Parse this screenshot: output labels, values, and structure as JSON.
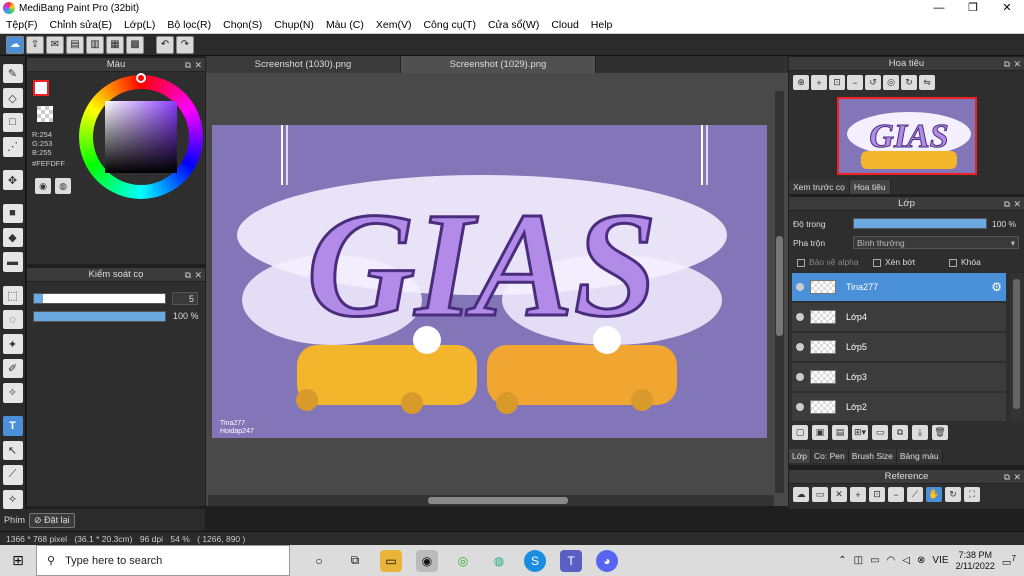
{
  "window": {
    "title": "MediBang Paint Pro (32bit)",
    "minimize": "—",
    "maximize": "❐",
    "close": "✕"
  },
  "menu": [
    "Tệp(F)",
    "Chỉnh sửa(E)",
    "Lớp(L)",
    "Bộ lọc(R)",
    "Chọn(S)",
    "Chụp(N)",
    "Màu (C)",
    "Xem(V)",
    "Công cụ(T)",
    "Cửa sổ(W)",
    "Cloud",
    "Help"
  ],
  "color_panel": {
    "title": "Màu",
    "r": "R:254",
    "g": "G:253",
    "b": "B:255",
    "hex": "#FEFDFF"
  },
  "brush_panel": {
    "title": "Kiểm soát cọ",
    "size_value": "5",
    "size_fraction": 0.07,
    "opacity_value": "100 %",
    "opacity_fraction": 1.0
  },
  "bottom_left": {
    "label": "Phím",
    "reset_label": "Đặt lại"
  },
  "tabs": [
    "Screenshot (1030).png",
    "Screenshot (1029).png"
  ],
  "artwork": {
    "title_text": "GIAS",
    "signature_line1": "Tina277",
    "signature_line2": "Hoidap247"
  },
  "navigator": {
    "title": "Hoa tiêu",
    "tab_preview": "Xem trước cọ",
    "tab_nav": "Hoa tiêu",
    "preview_text": "GIAS"
  },
  "layer_panel": {
    "title": "Lớp",
    "opacity_label": "Độ trong",
    "opacity_value": "100 %",
    "blend_label": "Pha trộn",
    "blend_value": "Bình thường",
    "protect_alpha": "Bảo vệ alpha",
    "clip": "Xén bớt",
    "lock": "Khóa",
    "layers": [
      {
        "name": "Tina277"
      },
      {
        "name": "Lớp4"
      },
      {
        "name": "Lớp5"
      },
      {
        "name": "Lớp3"
      },
      {
        "name": "Lớp2"
      }
    ],
    "tabs": [
      "Lớp",
      "Co: Pen",
      "Brush Size",
      "Bảng màu"
    ]
  },
  "reference_panel": {
    "title": "Reference"
  },
  "status": {
    "size": "1366 * 768 pixel",
    "cm": "(36.1 * 20.3cm)",
    "dpi": "96 dpi",
    "zoom": "54 %",
    "coords": "( 1266, 890 )"
  },
  "taskbar": {
    "search_placeholder": "Type here to search",
    "lang": "VIE",
    "time": "7:38 PM",
    "date": "2/11/2022",
    "notif_count": "7"
  }
}
